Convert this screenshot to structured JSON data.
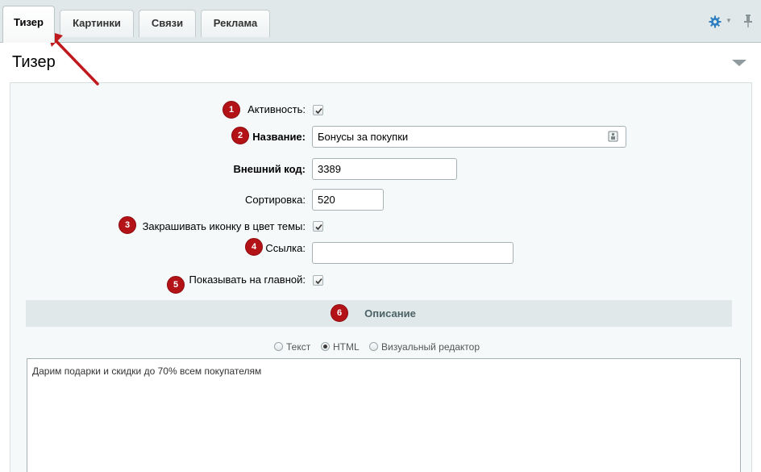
{
  "tabs": [
    {
      "label": "Тизер",
      "active": true
    },
    {
      "label": "Картинки",
      "active": false
    },
    {
      "label": "Связи",
      "active": false
    },
    {
      "label": "Реклама",
      "active": false
    }
  ],
  "toolbar": {
    "settings_icon": "gear-icon",
    "pin_icon": "pin-icon"
  },
  "section": {
    "title": "Тизер"
  },
  "form": {
    "active": {
      "label": "Активность:",
      "checked": true,
      "badge": "1"
    },
    "name": {
      "label": "Название:",
      "value": "Бонусы за покупки",
      "badge": "2"
    },
    "external_code": {
      "label": "Внешний код:",
      "value": "3389"
    },
    "sort": {
      "label": "Сортировка:",
      "value": "520"
    },
    "icon_color": {
      "label": "Закрашивать иконку в цвет темы:",
      "checked": true,
      "badge": "3"
    },
    "link": {
      "label": "Ссылка:",
      "value": "",
      "badge": "4"
    },
    "show_main": {
      "label": "Показывать на главной:",
      "checked": true,
      "badge": "5"
    }
  },
  "description": {
    "title": "Описание",
    "badge": "6",
    "modes": [
      {
        "label": "Текст",
        "checked": false
      },
      {
        "label": "HTML",
        "checked": true
      },
      {
        "label": "Визуальный редактор",
        "checked": false
      }
    ],
    "text": "Дарим подарки и скидки до 70% всем покупателям"
  },
  "colors": {
    "badge": "#b31217",
    "annotation_arrow": "#c0191e"
  }
}
